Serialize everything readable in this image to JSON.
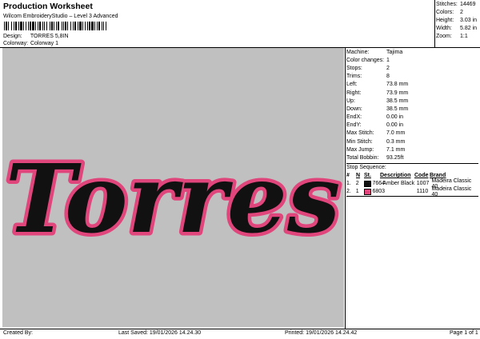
{
  "header": {
    "title": "Production Worksheet",
    "subtitle": "Wilcom EmbroideryStudio – Level 3 Advanced",
    "design_label": "Design:",
    "design_value": "TORRES 5,8IN",
    "colorway_label": "Colorway:",
    "colorway_value": "Colorway 1"
  },
  "summary": [
    {
      "k": "Stitches:",
      "v": "14469"
    },
    {
      "k": "Colors:",
      "v": "2"
    },
    {
      "k": "Height:",
      "v": "3.03 in"
    },
    {
      "k": "Width:",
      "v": "5.82 in"
    },
    {
      "k": "Zoom:",
      "v": "1:1"
    }
  ],
  "design_text": "Torres",
  "info": [
    {
      "k": "Machine:",
      "v": "Tajima"
    },
    {
      "k": "Color changes:",
      "v": "1"
    },
    {
      "k": "Stops:",
      "v": "2"
    },
    {
      "k": "Trims:",
      "v": "8"
    },
    {
      "k": "Left:",
      "v": "73.8 mm"
    },
    {
      "k": "Right:",
      "v": "73.9 mm"
    },
    {
      "k": "Up:",
      "v": "38.5 mm"
    },
    {
      "k": "Down:",
      "v": "38.5 mm"
    },
    {
      "k": "EndX:",
      "v": "0.00 in"
    },
    {
      "k": "EndY:",
      "v": "0.00 in"
    },
    {
      "k": "Max Stitch:",
      "v": "7.0 mm"
    },
    {
      "k": "Min Stitch:",
      "v": "0.3 mm"
    },
    {
      "k": "Max Jump:",
      "v": "7.1 mm"
    },
    {
      "k": "Total Bobbin:",
      "v": "93.25ft"
    }
  ],
  "stop_sequence": {
    "title": "Stop Sequence:",
    "headers": {
      "num": "#",
      "n": "N",
      "st": "St.",
      "desc": "Description",
      "code": "Code",
      "brand": "Brand"
    },
    "rows": [
      {
        "num": "1.",
        "n": "2",
        "st": "7664",
        "desc": "Amber Black",
        "code": "1007",
        "brand": "Madeira Classic 40",
        "color": "#111111"
      },
      {
        "num": "2.",
        "n": "1",
        "st": "6803",
        "desc": "",
        "code": "1110",
        "brand": "Madeira Classic 40",
        "color": "#e0457b"
      }
    ]
  },
  "footer": {
    "created": "Created By:",
    "saved": "Last Saved: 19/01/2026 14.24.30",
    "printed": "Printed: 19/01/2026 14.24.42",
    "page": "Page 1 of 1"
  },
  "colors": {
    "canvas": "#c0c0c0",
    "thread_pink": "#e0457b",
    "thread_black": "#111111"
  }
}
